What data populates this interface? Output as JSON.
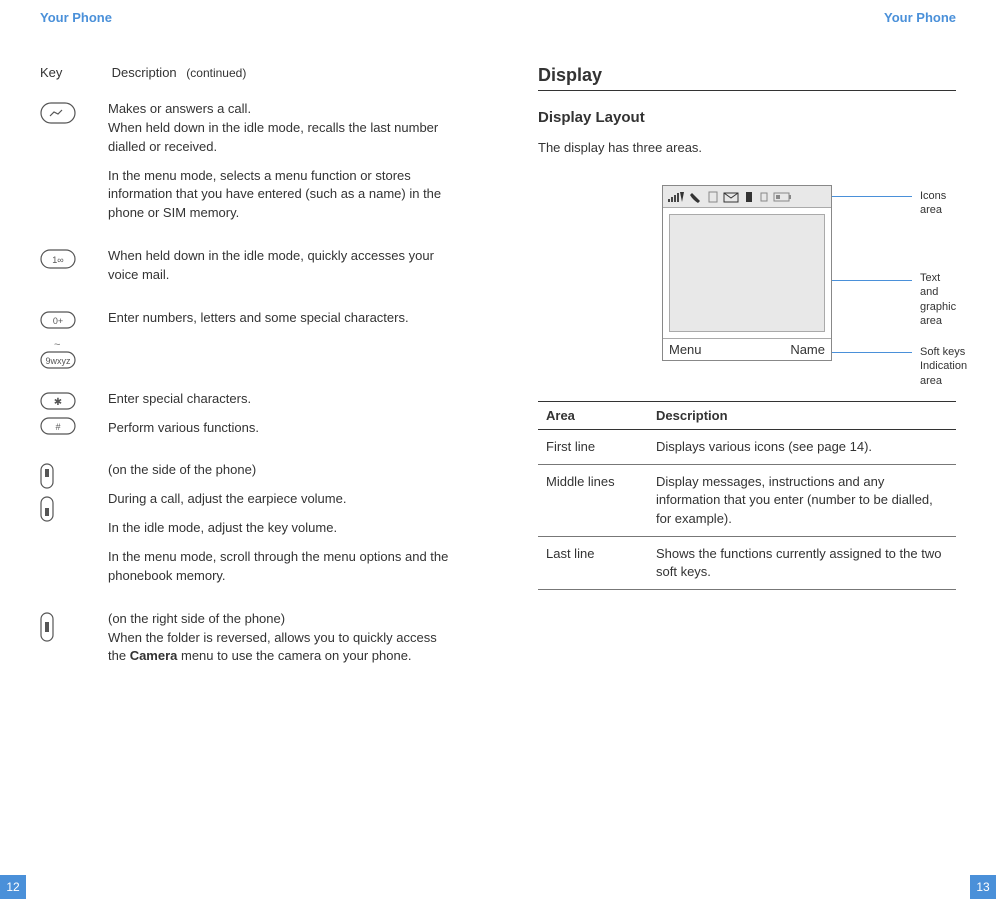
{
  "header": {
    "left": "Your Phone",
    "right": "Your Phone"
  },
  "left_page": {
    "table_head": {
      "key": "Key",
      "desc": "Description",
      "continued": "(continued)"
    },
    "rows": [
      {
        "icon": "send-key",
        "paras": [
          "Makes or answers a call.\nWhen held down in the idle mode, recalls the last number dialled or received.",
          "In the menu mode, selects a menu function or stores information that you have entered (such as a name) in the phone or SIM memory."
        ]
      },
      {
        "icon": "voicemail-key",
        "paras": [
          "When held down in the idle mode, quickly accesses your voice mail."
        ]
      },
      {
        "icon": "numeric-keys",
        "paras": [
          "Enter numbers, letters and some special characters."
        ]
      },
      {
        "icon": "star-hash-keys",
        "paras": [
          "Enter special characters.",
          "Perform various functions."
        ]
      },
      {
        "icon": "volume-keys",
        "paras": [
          "(on the side of the phone)",
          "During a call, adjust the earpiece volume.",
          "In the idle mode, adjust the key volume.",
          "In the menu mode, scroll through the menu options and the phonebook memory."
        ]
      },
      {
        "icon": "camera-key",
        "paras_html": "(on the right side of the phone)\nWhen the folder is reversed, allows you to quickly access the <b>Camera</b> menu to use the camera on your phone."
      }
    ],
    "page_num": "12"
  },
  "right_page": {
    "title": "Display",
    "subtitle": "Display Layout",
    "intro": "The display has three areas.",
    "diagram": {
      "softkey_left": "Menu",
      "softkey_right": "Name",
      "callouts": {
        "icons": "Icons area",
        "text": "Text and\ngraphic area",
        "soft": "Soft keys\nIndication area"
      }
    },
    "area_table": {
      "head": {
        "area": "Area",
        "desc": "Description"
      },
      "rows": [
        {
          "area": "First line",
          "desc": "Displays various icons (see page 14)."
        },
        {
          "area": "Middle lines",
          "desc": "Display messages, instructions and any information that you enter (number to be dialled, for example)."
        },
        {
          "area": "Last line",
          "desc": "Shows the functions currently assigned to the two soft keys."
        }
      ]
    },
    "page_num": "13"
  }
}
